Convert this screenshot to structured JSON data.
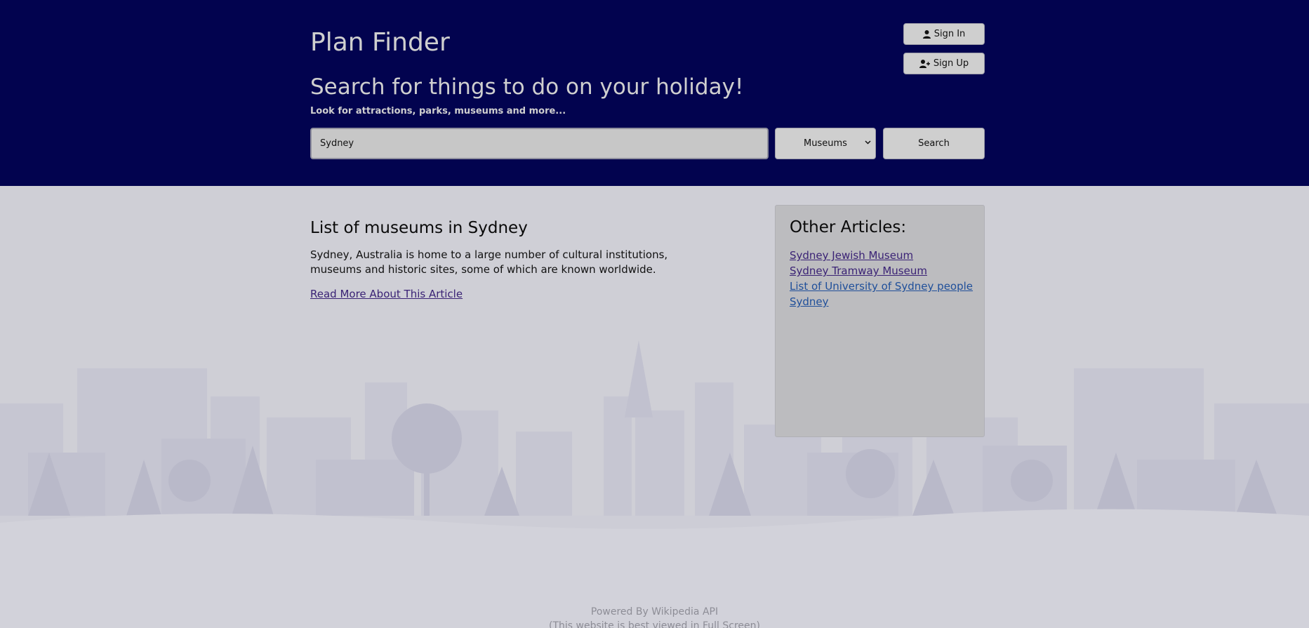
{
  "header": {
    "app_title": "Plan Finder",
    "heading": "Search for things to do on your holiday!",
    "subheading": "Look for attractions, parks, museums and more...",
    "sign_in_label": "Sign In",
    "sign_up_label": "Sign Up",
    "sign_in_icon": "user-icon",
    "sign_up_icon": "user-plus-icon"
  },
  "search": {
    "query_value": "Sydney",
    "category_selected": "Museums",
    "button_label": "Search"
  },
  "article": {
    "title": "List of museums in Sydney",
    "summary": "Sydney, Australia is home to a large number of cultural institutions, museums and historic sites, some of which are known worldwide.",
    "read_more_label": "Read More About This Article"
  },
  "sidebar": {
    "heading": "Other Articles:",
    "links": [
      {
        "label": "Sydney Jewish Museum",
        "visited": true
      },
      {
        "label": "Sydney Tramway Museum",
        "visited": true
      },
      {
        "label": "List of University of Sydney people",
        "visited": false
      },
      {
        "label": "Sydney",
        "visited": false
      }
    ]
  },
  "footer": {
    "line1": "Powered By Wikipedia API",
    "line2": "(This website is best viewed in Full Screen)"
  },
  "colors": {
    "header_bg": "#02034f",
    "page_bg": "#cfcfd6",
    "sidebar_bg": "#bcbcbf",
    "link_visited": "#3a2275",
    "link_unvisited": "#1f4f9a"
  }
}
